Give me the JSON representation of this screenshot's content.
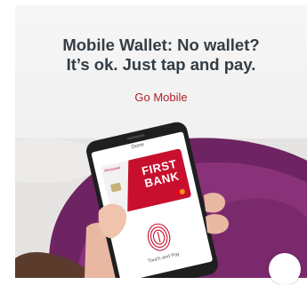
{
  "banner": {
    "headline_line1": "Mobile Wallet: No wallet?",
    "headline_line2": "It’s ok. Just tap and pay.",
    "cta_label": "Go Mobile"
  },
  "phone": {
    "header_label": "Done",
    "footer_label": "Touch and Pay"
  },
  "card": {
    "bank_line1": "FIRST",
    "bank_line2": "BANK",
    "brand": "Personal",
    "network_icon": "mastercard-logo",
    "color": "#c8102e"
  },
  "colors": {
    "headline": "#343d45",
    "cta": "#b3202a",
    "sweater": "#7a2a6c"
  }
}
